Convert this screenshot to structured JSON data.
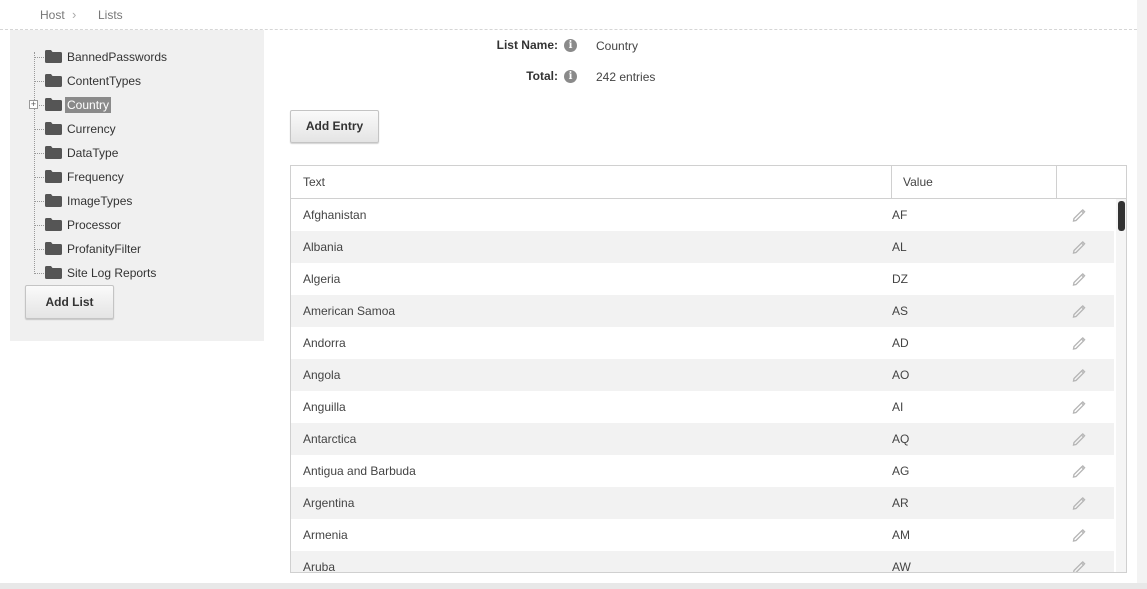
{
  "breadcrumb": {
    "host": "Host",
    "separator": "›",
    "lists": "Lists"
  },
  "sidebar": {
    "items": [
      {
        "label": "BannedPasswords",
        "icon": "folder-icon",
        "selected": false,
        "expandable": false
      },
      {
        "label": "ContentTypes",
        "icon": "folder-icon",
        "selected": false,
        "expandable": false
      },
      {
        "label": "Country",
        "icon": "folder-icon",
        "selected": true,
        "expandable": true
      },
      {
        "label": "Currency",
        "icon": "folder-icon",
        "selected": false,
        "expandable": false
      },
      {
        "label": "DataType",
        "icon": "folder-icon",
        "selected": false,
        "expandable": false
      },
      {
        "label": "Frequency",
        "icon": "folder-icon",
        "selected": false,
        "expandable": false
      },
      {
        "label": "ImageTypes",
        "icon": "folder-icon",
        "selected": false,
        "expandable": false
      },
      {
        "label": "Processor",
        "icon": "folder-icon",
        "selected": false,
        "expandable": false
      },
      {
        "label": "ProfanityFilter",
        "icon": "folder-icon",
        "selected": false,
        "expandable": false
      },
      {
        "label": "Site Log Reports",
        "icon": "folder-icon",
        "selected": false,
        "expandable": false
      }
    ],
    "expander_symbol": "+",
    "add_list_label": "Add List"
  },
  "details": {
    "list_name_label": "List Name:",
    "list_name_value": "Country",
    "total_label": "Total:",
    "total_value": "242 entries",
    "info_icon": "i"
  },
  "add_entry_label": "Add Entry",
  "grid": {
    "columns": {
      "text": "Text",
      "value": "Value"
    },
    "rows": [
      {
        "text": "Afghanistan",
        "value": "AF"
      },
      {
        "text": "Albania",
        "value": "AL"
      },
      {
        "text": "Algeria",
        "value": "DZ"
      },
      {
        "text": "American Samoa",
        "value": "AS"
      },
      {
        "text": "Andorra",
        "value": "AD"
      },
      {
        "text": "Angola",
        "value": "AO"
      },
      {
        "text": "Anguilla",
        "value": "AI"
      },
      {
        "text": "Antarctica",
        "value": "AQ"
      },
      {
        "text": "Antigua and Barbuda",
        "value": "AG"
      },
      {
        "text": "Argentina",
        "value": "AR"
      },
      {
        "text": "Armenia",
        "value": "AM"
      },
      {
        "text": "Aruba",
        "value": "AW"
      }
    ],
    "edit_icon": "pencil-icon"
  },
  "colors": {
    "selected_bg": "#8a8a8a",
    "sidebar_bg": "#f0f0f0",
    "row_alt_bg": "#f2f2f2"
  }
}
